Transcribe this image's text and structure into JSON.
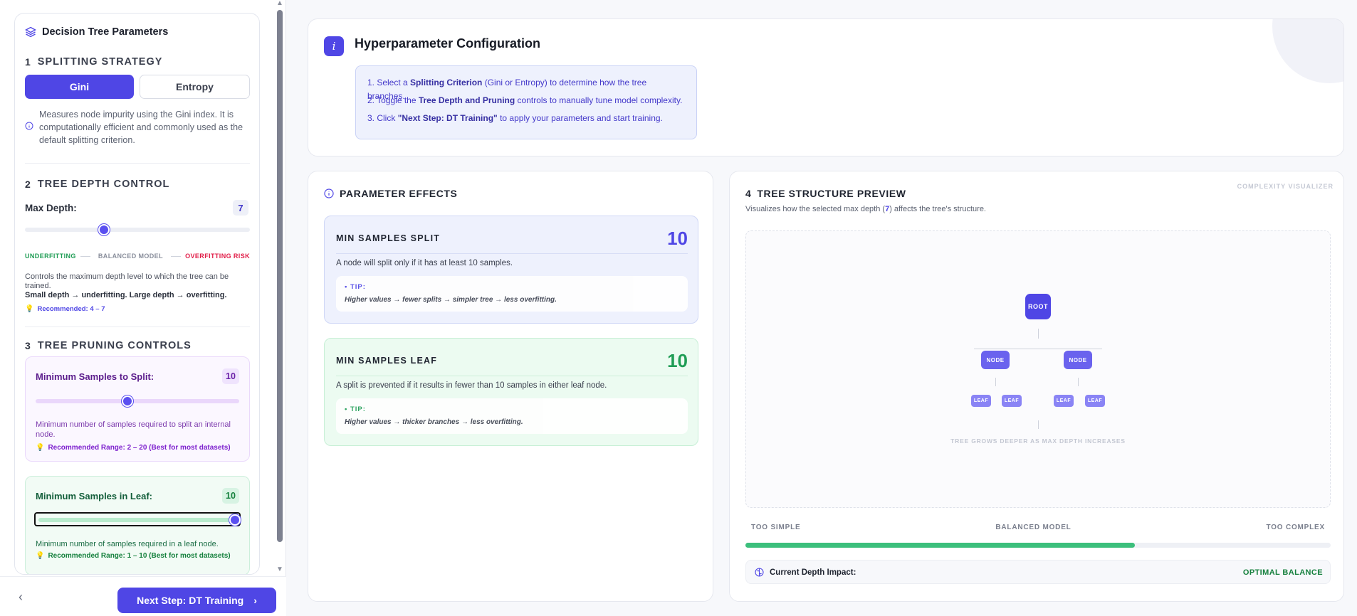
{
  "sidebar": {
    "title": "Decision Tree Parameters",
    "splitting": {
      "number": "1",
      "heading": "SPLITTING STRATEGY",
      "options": [
        "Gini",
        "Entropy"
      ],
      "selected": "Gini",
      "description": "Measures node impurity using the Gini index. It is computationally efficient and commonly used as the default splitting criterion."
    },
    "depth": {
      "number": "2",
      "heading": "TREE DEPTH CONTROL",
      "label": "Max Depth:",
      "value": "7",
      "slider_fraction": 0.35,
      "scale_left": "UNDERFITTING",
      "scale_mid": "BALANCED MODEL",
      "scale_right": "OVERFITTING RISK",
      "desc_line1": "Controls the maximum depth level to which the tree can be trained.",
      "desc_line2": "Small depth → underfitting. Large depth → overfitting.",
      "recommended": "Recommended: 4 – 7"
    },
    "pruning": {
      "number": "3",
      "heading": "TREE PRUNING CONTROLS",
      "split": {
        "label": "Minimum Samples to Split:",
        "value": "10",
        "slider_fraction": 0.45,
        "description": "Minimum number of samples required to split an internal node.",
        "recommended": "Recommended Range: 2 – 20 (Best for most datasets)"
      },
      "leaf": {
        "label": "Minimum Samples in Leaf:",
        "value": "10",
        "slider_fraction": 1.0,
        "description": "Minimum number of samples required in a leaf node.",
        "recommended": "Recommended Range: 1 – 10 (Best for most datasets)"
      }
    },
    "next_button": "Next Step: DT Training"
  },
  "config": {
    "title": "Hyperparameter Configuration",
    "step1_pre": "1.  Select a ",
    "step1_bold": "Splitting Criterion",
    "step1_post": " (Gini or Entropy) to determine how the tree branches.",
    "step2_pre": "2.  Toggle the ",
    "step2_bold": "Tree Depth and Pruning",
    "step2_post": " controls to manually tune model complexity.",
    "step3_pre": "3.  Click ",
    "step3_bold": "\"Next Step: DT Training\"",
    "step3_post": " to apply your parameters and start training."
  },
  "effects": {
    "heading": "PARAMETER EFFECTS",
    "split": {
      "title": "MIN SAMPLES SPLIT",
      "value": "10",
      "description": "A node will split only if it has at least 10 samples.",
      "tip_label": "• TIP:",
      "tip_text": "Higher values → fewer splits → simpler tree → less overfitting."
    },
    "leaf": {
      "title": "MIN SAMPLES LEAF",
      "value": "10",
      "description": "A split is prevented if it results in fewer than 10 samples in either leaf node.",
      "tip_label": "• TIP:",
      "tip_text": "Higher values → thicker branches → less overfitting."
    }
  },
  "tree": {
    "number": "4",
    "heading": "TREE STRUCTURE PREVIEW",
    "badge": "COMPLEXITY VISUALIZER",
    "sub_pre": "Visualizes how the selected max depth (",
    "sub_value": "7",
    "sub_post": ") affects the tree's structure.",
    "root_label": "ROOT",
    "node_label": "NODE",
    "leaf_label": "LEAF",
    "caption": "TREE GROWS DEEPER AS MAX DEPTH INCREASES",
    "scale_left": "TOO SIMPLE",
    "scale_mid": "BALANCED MODEL",
    "scale_right": "TOO COMPLEX",
    "complexity_fraction": 0.665,
    "impact_label": "Current Depth Impact:",
    "impact_value": "OPTIMAL BALANCE"
  },
  "colors": {
    "accent": "#4f46e5",
    "success": "#1f9d55",
    "danger": "#e11d48",
    "purple": "#7e22ce"
  }
}
